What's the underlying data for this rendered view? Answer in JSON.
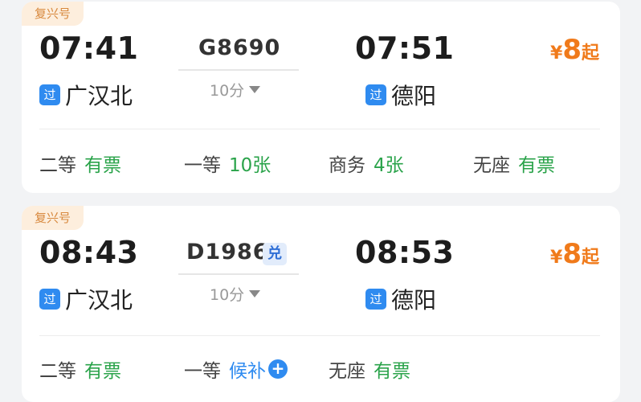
{
  "trains": [
    {
      "brand": "复兴号",
      "dep_time": "07:41",
      "dep_station": "广汉北",
      "dep_badge": "过",
      "train_no": "G8690",
      "duration": "10分",
      "arr_time": "07:51",
      "arr_station": "德阳",
      "arr_badge": "过",
      "price_currency": "¥",
      "price": "8",
      "price_suffix": "起",
      "seats": [
        {
          "class": "二等",
          "status": "有票"
        },
        {
          "class": "一等",
          "status": "10张"
        },
        {
          "class": "商务",
          "status": "4张"
        },
        {
          "class": "无座",
          "status": "有票"
        }
      ]
    },
    {
      "brand": "复兴号",
      "dep_time": "08:43",
      "dep_station": "广汉北",
      "dep_badge": "过",
      "train_no": "D1986",
      "tag": "兑",
      "duration": "10分",
      "arr_time": "08:53",
      "arr_station": "德阳",
      "arr_badge": "过",
      "price_currency": "¥",
      "price": "8",
      "price_suffix": "起",
      "seats": [
        {
          "class": "二等",
          "status": "有票"
        },
        {
          "class": "一等",
          "status": "候补"
        },
        {
          "class": "无座",
          "status": "有票"
        }
      ]
    }
  ],
  "colors": {
    "accent_orange": "#f07a1a",
    "available_green": "#2aa34a",
    "blue": "#2f8bf0",
    "brand_bg": "#fdeedd"
  },
  "icons": {
    "duration_toggle": "caret-down-icon",
    "waitlist_add": "plus-circle-icon"
  }
}
